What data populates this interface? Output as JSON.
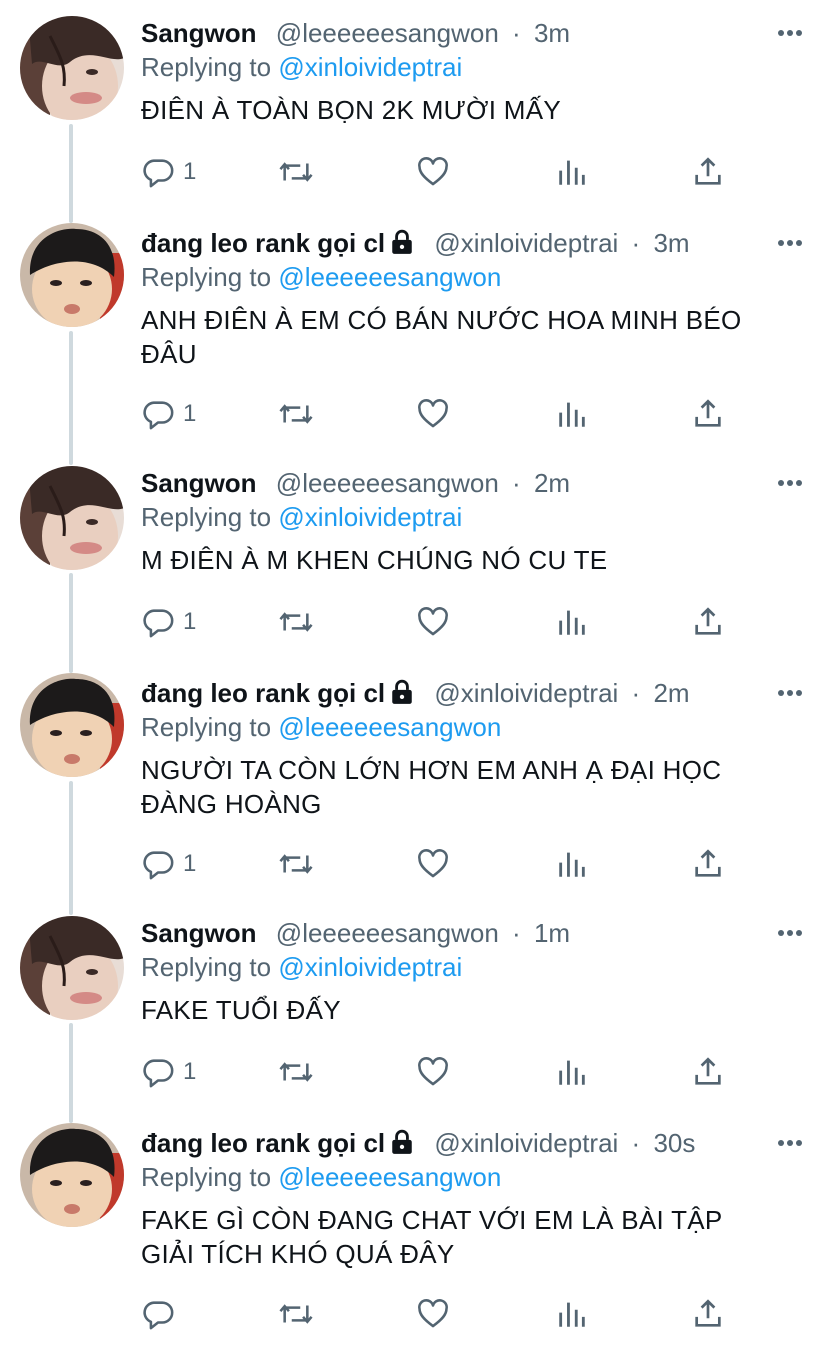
{
  "thread": {
    "tweets": [
      {
        "name": "Sangwon",
        "handle": "@leeeeeesangwon",
        "time": "3m",
        "locked": false,
        "replying_prefix": "Replying to",
        "replying_to": "@xinloivideptrai",
        "text": "ĐIÊN À TOÀN BỌN 2K MƯỜI MẤY",
        "reply_count": "1"
      },
      {
        "name": "đang leo rank gọi cl",
        "handle": "@xinloivideptrai",
        "time": "3m",
        "locked": true,
        "replying_prefix": "Replying to",
        "replying_to": "@leeeeeesangwon",
        "text_lines": [
          "ANH ĐIÊN À EM CÓ BÁN NƯỚC HOA MINH BÉO",
          "ĐÂU"
        ],
        "reply_count": "1"
      },
      {
        "name": "Sangwon",
        "handle": "@leeeeeesangwon",
        "time": "2m",
        "locked": false,
        "replying_prefix": "Replying to",
        "replying_to": "@xinloivideptrai",
        "text": "M ĐIÊN À M KHEN CHÚNG NÓ CU TE",
        "reply_count": "1"
      },
      {
        "name": "đang leo rank gọi cl",
        "handle": "@xinloivideptrai",
        "time": "2m",
        "locked": true,
        "replying_prefix": "Replying to",
        "replying_to": "@leeeeeesangwon",
        "text_lines": [
          "NGƯỜI TA CÒN LỚN HƠN EM ANH Ạ ĐẠI HỌC",
          "ĐÀNG HOÀNG"
        ],
        "reply_count": "1"
      },
      {
        "name": "Sangwon",
        "handle": "@leeeeeesangwon",
        "time": "1m",
        "locked": false,
        "replying_prefix": "Replying to",
        "replying_to": "@xinloivideptrai",
        "text": "FAKE TUỔI ĐẤY",
        "reply_count": "1"
      },
      {
        "name": "đang leo rank gọi cl",
        "handle": "@xinloivideptrai",
        "time": "30s",
        "locked": true,
        "replying_prefix": "Replying to",
        "replying_to": "@leeeeeesangwon",
        "text_lines": [
          "FAKE GÌ CÒN ĐANG CHAT VỚI EM LÀ BÀI TẬP",
          "GIẢI TÍCH KHÓ QUÁ ĐÂY"
        ],
        "reply_count": ""
      }
    ]
  },
  "icons": {
    "reply": "reply-icon",
    "retweet": "retweet-icon",
    "like": "like-icon",
    "views": "views-icon",
    "share": "share-icon",
    "more": "more-icon",
    "lock": "lock-icon"
  },
  "colors": {
    "text": "#0f1419",
    "secondary": "#536471",
    "link": "#1d9bf0",
    "thread_line": "#cfd9de"
  }
}
